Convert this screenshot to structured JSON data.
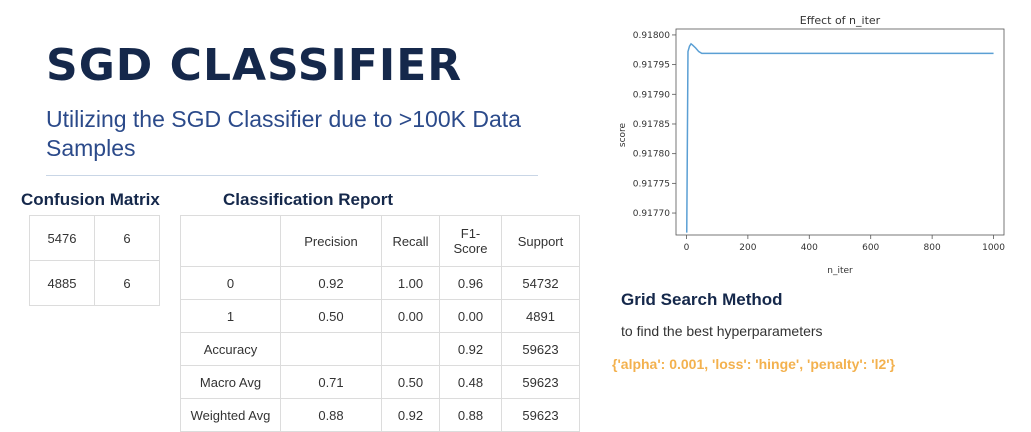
{
  "header": {
    "title": "SGD CLASSIFIER",
    "subtitle": "Utilizing the SGD Classifier due to >100K Data Samples"
  },
  "confusion_matrix": {
    "heading": "Confusion Matrix",
    "rows": [
      [
        "5476",
        "6"
      ],
      [
        "4885",
        "6"
      ]
    ]
  },
  "classification_report": {
    "heading": "Classification Report",
    "columns": [
      "",
      "Precision",
      "Recall",
      "F1-Score",
      "Support"
    ],
    "rows": [
      [
        "0",
        "0.92",
        "1.00",
        "0.96",
        "54732"
      ],
      [
        "1",
        "0.50",
        "0.00",
        "0.00",
        "4891"
      ],
      [
        "Accuracy",
        "",
        "",
        "0.92",
        "59623"
      ],
      [
        "Macro Avg",
        "0.71",
        "0.50",
        "0.48",
        "59623"
      ],
      [
        "Weighted Avg",
        "0.88",
        "0.92",
        "0.88",
        "59623"
      ]
    ]
  },
  "grid_search": {
    "title": "Grid Search Method",
    "description": "to find the best hyperparameters",
    "params": "{'alpha': 0.001, 'loss': 'hinge', 'penalty': 'l2'}"
  },
  "colors": {
    "line": "#5a9fd4",
    "params": "#f3b14e",
    "title": "#15284b"
  },
  "chart_data": {
    "type": "line",
    "title": "Effect of n_iter",
    "xlabel": "n_iter",
    "ylabel": "score",
    "xlim": [
      -34,
      1034
    ],
    "ylim": [
      0.917663,
      0.91801
    ],
    "xticks": [
      0,
      200,
      400,
      600,
      800,
      1000
    ],
    "yticks": [
      0.9177,
      0.91775,
      0.9178,
      0.91785,
      0.9179,
      0.91795,
      0.918
    ],
    "xtick_labels": [
      "0",
      "200",
      "400",
      "600",
      "800",
      "1000"
    ],
    "ytick_labels": [
      "0.91770",
      "0.91775",
      "0.91780",
      "0.91785",
      "0.91790",
      "0.91795",
      "0.91800"
    ],
    "grid": false,
    "x": [
      1,
      5,
      10,
      15,
      20,
      30,
      40,
      50,
      100,
      200,
      400,
      600,
      800,
      1000
    ],
    "y": [
      0.917667,
      0.917972,
      0.917981,
      0.917985,
      0.917983,
      0.917978,
      0.917972,
      0.917969,
      0.917969,
      0.917969,
      0.917969,
      0.917969,
      0.917969,
      0.917969
    ]
  }
}
